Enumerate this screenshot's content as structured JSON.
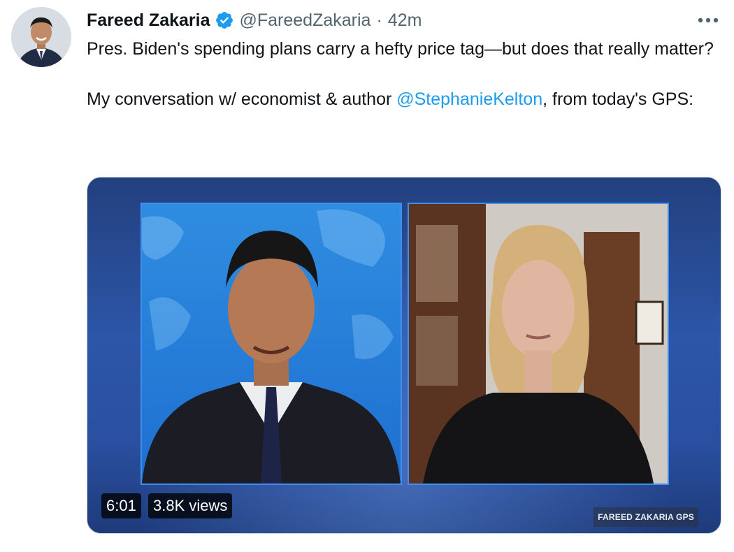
{
  "tweet": {
    "display_name": "Fareed Zakaria",
    "handle": "@FareedZakaria",
    "separator": "·",
    "time": "42m",
    "text_line1": "Pres. Biden's spending plans carry a hefty price tag—but does that really matter?",
    "text_line2_prefix": "My conversation w/ economist & author ",
    "text_line2_mention": "@StephanieKelton",
    "text_line2_suffix": ", from today's GPS:"
  },
  "icons": {
    "verified": "verified-badge-icon",
    "more": "more-horizontal-icon"
  },
  "video": {
    "duration": "6:01",
    "views": "3.8K views",
    "watermark": "FAREED ZAKARIA GPS"
  },
  "colors": {
    "link": "#1d9bf0",
    "secondary_text": "#536471",
    "verified": "#1d9bf0"
  }
}
